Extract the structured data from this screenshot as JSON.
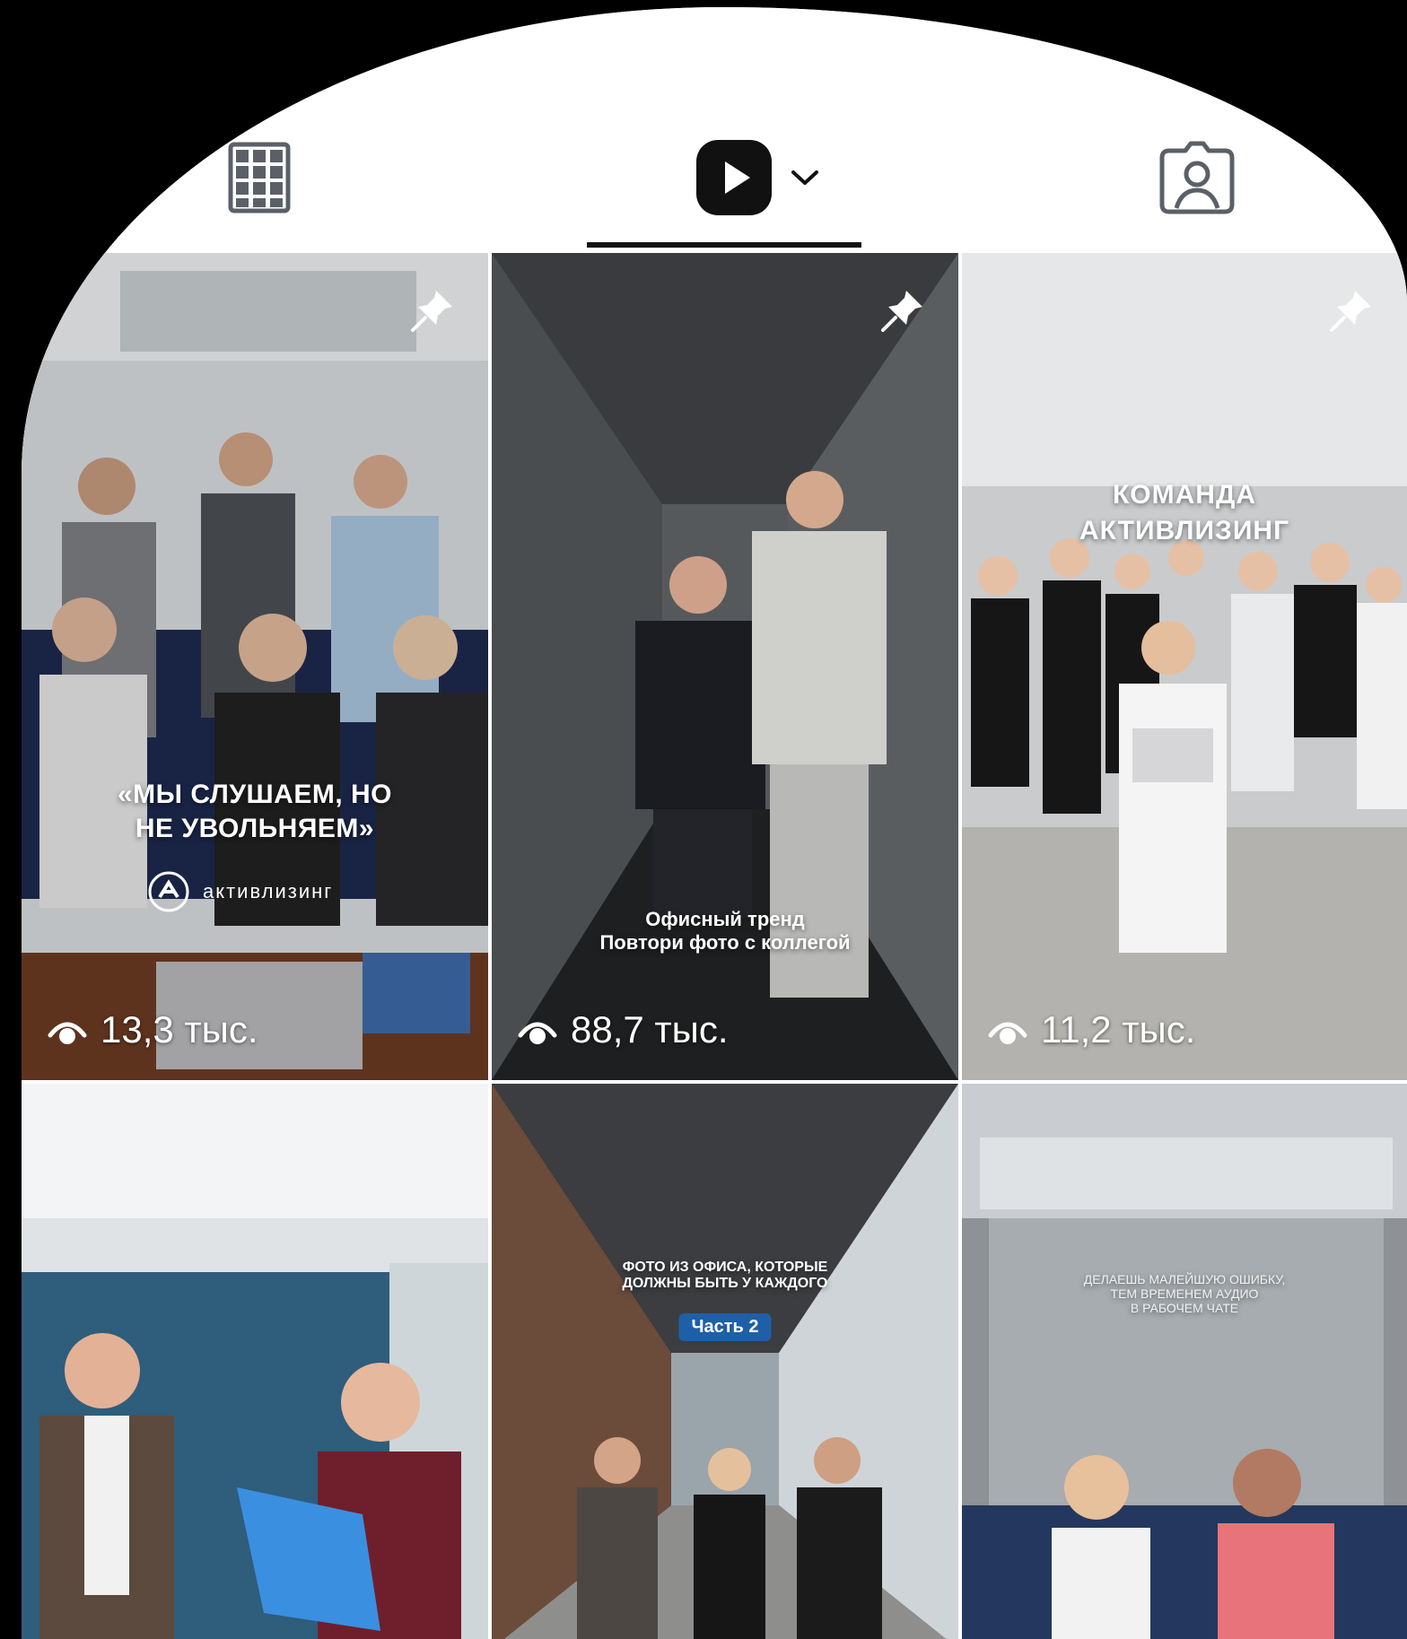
{
  "tabs": {
    "grid": {
      "icon": "grid-icon"
    },
    "reels": {
      "icon": "reels-play-icon",
      "dropdown_icon": "chevron-down-icon",
      "active": true
    },
    "tagged": {
      "icon": "tagged-person-icon"
    }
  },
  "reels": [
    {
      "caption_lines": [
        "«МЫ СЛУШАЕМ, НО",
        "НЕ УВОЛЬНЯЕМ»"
      ],
      "brand": "активлизинг",
      "views": "13,3 тыс.",
      "pinned": true
    },
    {
      "caption_lines": [
        "Офисный тренд",
        "Повтори фото с коллегой"
      ],
      "views": "88,7 тыс.",
      "pinned": true
    },
    {
      "caption_lines": [
        "КОМАНДА",
        "АКТИВЛИЗИНГ"
      ],
      "views": "11,2 тыс.",
      "pinned": true
    },
    {
      "caption_lines": [],
      "views": "",
      "pinned": false
    },
    {
      "caption_lines": [
        "ФОТО ИЗ ОФИСА, КОТОРЫЕ",
        "ДОЛЖНЫ БЫТЬ У КАЖДОГО"
      ],
      "badge": "Часть 2",
      "views": "",
      "pinned": false
    },
    {
      "caption_lines": [
        "ДЕЛАЕШЬ МАЛЕЙШУЮ ОШИБКУ,",
        "ТЕМ ВРЕМЕНЕМ АУДИО",
        "В РАБОЧЕМ ЧАТЕ"
      ],
      "views": "",
      "pinned": false
    }
  ],
  "colors": {
    "accent_dark": "#111111",
    "badge_blue": "#1f5fa8"
  }
}
